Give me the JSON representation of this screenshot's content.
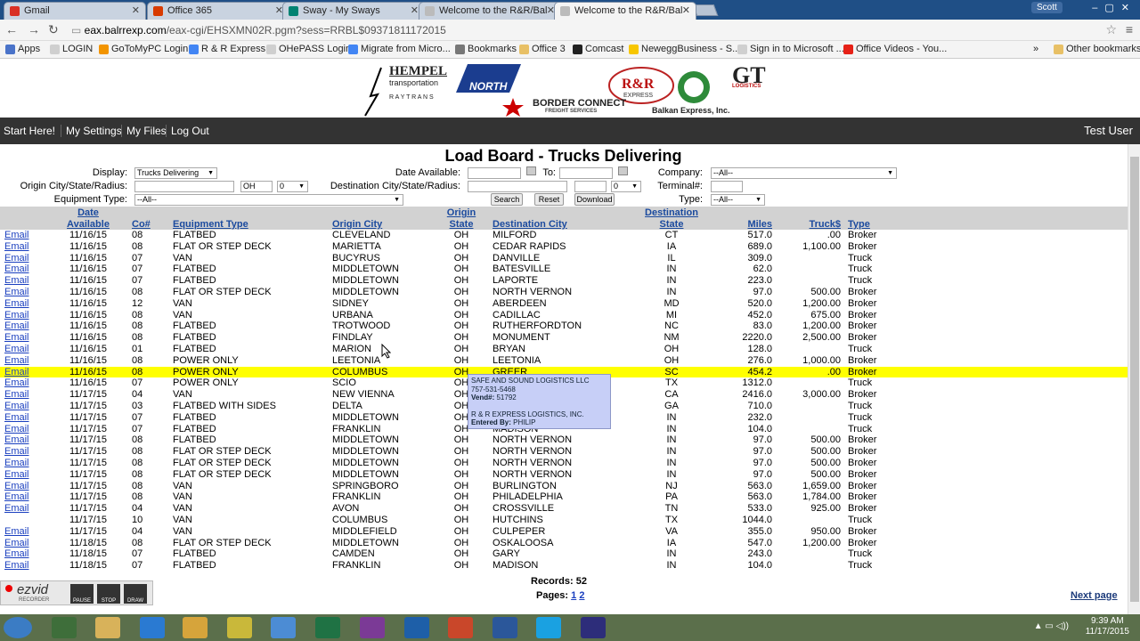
{
  "browser": {
    "tabs": [
      {
        "label": "Gmail",
        "color": "#d93025"
      },
      {
        "label": "Office 365",
        "color": "#d83b01"
      },
      {
        "label": "Sway - My Sways",
        "color": "#008272"
      },
      {
        "label": "Welcome to the R&R/Bal",
        "color": "#999999"
      },
      {
        "label": "Welcome to the R&R/Bal",
        "color": "#999999"
      }
    ],
    "profile": "Scott",
    "url_host": "eax.balrrexp.com",
    "url_path": "/eax-cgi/EHSXMN02R.pgm?sess=RRBL$09371811172015",
    "bookmarks": [
      {
        "label": "Apps",
        "color": "#4a73c9"
      },
      {
        "label": "LOGIN",
        "color": "#cfcfcf"
      },
      {
        "label": "GoToMyPC Login",
        "color": "#f29400"
      },
      {
        "label": "R & R Express",
        "color": "#4285f4"
      },
      {
        "label": "OHePASS Login",
        "color": "#cfcfcf"
      },
      {
        "label": "Migrate from Micro...",
        "color": "#4285f4"
      },
      {
        "label": "Bookmarks",
        "color": "#777777"
      },
      {
        "label": "Office 3",
        "color": "#e8c066"
      },
      {
        "label": "Comcast",
        "color": "#222222"
      },
      {
        "label": "NeweggBusiness - S...",
        "color": "#f7c600"
      },
      {
        "label": "Sign in to Microsoft ...",
        "color": "#cfcfcf"
      },
      {
        "label": "Office Videos - You...",
        "color": "#e62117"
      }
    ],
    "other_bookmarks": "Other bookmarks"
  },
  "logos": {
    "hempel": "HEMPEL",
    "hempel_sub": "transportation",
    "raytrans": "R A Y T R A N S",
    "north": "NORTH",
    "border_connect": "BORDER CONNECT",
    "border_connect_sub": "FREIGHT SERVICES",
    "rr": "R&R",
    "rr_sub": "EXPRESS",
    "gt": "GT",
    "gt_sub": "LOGISTICS",
    "balkan": "Balkan Express, Inc."
  },
  "nav": {
    "start_here": "Start Here!",
    "my_settings": "My Settings",
    "my_files": "My Files",
    "log_out": "Log Out",
    "user": "Test User"
  },
  "page_title": "Load Board - Trucks Delivering",
  "filters": {
    "display_label": "Display:",
    "display_value": "Trucks Delivering",
    "date_available_label": "Date Available:",
    "to_label": "To:",
    "company_label": "Company:",
    "company_value": "--All--",
    "origin_label": "Origin City/State/Radius:",
    "origin_state": "OH",
    "origin_radius": "0",
    "destination_label": "Destination City/State/Radius:",
    "destination_radius": "0",
    "terminal_label": "Terminal#:",
    "equipment_label": "Equipment Type:",
    "equipment_value": "--All--",
    "search_button": "Search",
    "reset_button": "Reset",
    "download_button": "Download",
    "type_label": "Type:",
    "type_value": "--All--"
  },
  "table": {
    "headers": {
      "date_1": "Date",
      "date_2": "Available",
      "co": "Co#",
      "equipment": "Equipment Type",
      "origin_city": "Origin City",
      "origin_state_1": "Origin",
      "origin_state_2": "State",
      "dest_city": "Destination City",
      "dest_state_1": "Destination",
      "dest_state_2": "State",
      "miles": "Miles",
      "truck": "Truck$",
      "type": "Type"
    },
    "rows": [
      {
        "email": "Email",
        "date": "11/16/15",
        "co": "08",
        "equip": "FLATBED",
        "ocity": "CLEVELAND",
        "ost": "OH",
        "dcity": "MILFORD",
        "dst": "CT",
        "miles": "517.0",
        "truck": ".00",
        "type": "Broker"
      },
      {
        "email": "Email",
        "date": "11/16/15",
        "co": "08",
        "equip": "FLAT OR STEP DECK",
        "ocity": "MARIETTA",
        "ost": "OH",
        "dcity": "CEDAR RAPIDS",
        "dst": "IA",
        "miles": "689.0",
        "truck": "1,100.00",
        "type": "Broker"
      },
      {
        "email": "Email",
        "date": "11/16/15",
        "co": "07",
        "equip": "VAN",
        "ocity": "BUCYRUS",
        "ost": "OH",
        "dcity": "DANVILLE",
        "dst": "IL",
        "miles": "309.0",
        "truck": "",
        "type": "Truck"
      },
      {
        "email": "Email",
        "date": "11/16/15",
        "co": "07",
        "equip": "FLATBED",
        "ocity": "MIDDLETOWN",
        "ost": "OH",
        "dcity": "BATESVILLE",
        "dst": "IN",
        "miles": "62.0",
        "truck": "",
        "type": "Truck"
      },
      {
        "email": "Email",
        "date": "11/16/15",
        "co": "07",
        "equip": "FLATBED",
        "ocity": "MIDDLETOWN",
        "ost": "OH",
        "dcity": "LAPORTE",
        "dst": "IN",
        "miles": "223.0",
        "truck": "",
        "type": "Truck"
      },
      {
        "email": "Email",
        "date": "11/16/15",
        "co": "08",
        "equip": "FLAT OR STEP DECK",
        "ocity": "MIDDLETOWN",
        "ost": "OH",
        "dcity": "NORTH VERNON",
        "dst": "IN",
        "miles": "97.0",
        "truck": "500.00",
        "type": "Broker"
      },
      {
        "email": "Email",
        "date": "11/16/15",
        "co": "12",
        "equip": "VAN",
        "ocity": "SIDNEY",
        "ost": "OH",
        "dcity": "ABERDEEN",
        "dst": "MD",
        "miles": "520.0",
        "truck": "1,200.00",
        "type": "Broker"
      },
      {
        "email": "Email",
        "date": "11/16/15",
        "co": "08",
        "equip": "VAN",
        "ocity": "URBANA",
        "ost": "OH",
        "dcity": "CADILLAC",
        "dst": "MI",
        "miles": "452.0",
        "truck": "675.00",
        "type": "Broker"
      },
      {
        "email": "Email",
        "date": "11/16/15",
        "co": "08",
        "equip": "FLATBED",
        "ocity": "TROTWOOD",
        "ost": "OH",
        "dcity": "RUTHERFORDTON",
        "dst": "NC",
        "miles": "83.0",
        "truck": "1,200.00",
        "type": "Broker"
      },
      {
        "email": "Email",
        "date": "11/16/15",
        "co": "08",
        "equip": "FLATBED",
        "ocity": "FINDLAY",
        "ost": "OH",
        "dcity": "MONUMENT",
        "dst": "NM",
        "miles": "2220.0",
        "truck": "2,500.00",
        "type": "Broker"
      },
      {
        "email": "Email",
        "date": "11/16/15",
        "co": "01",
        "equip": "FLATBED",
        "ocity": "MARION",
        "ost": "OH",
        "dcity": "BRYAN",
        "dst": "OH",
        "miles": "128.0",
        "truck": "",
        "type": "Truck"
      },
      {
        "email": "Email",
        "date": "11/16/15",
        "co": "08",
        "equip": "POWER ONLY",
        "ocity": "LEETONIA",
        "ost": "OH",
        "dcity": "LEETONIA",
        "dst": "OH",
        "miles": "276.0",
        "truck": "1,000.00",
        "type": "Broker"
      },
      {
        "email": "Email",
        "date": "11/16/15",
        "co": "08",
        "equip": "POWER ONLY",
        "ocity": "COLUMBUS",
        "ost": "OH",
        "dcity": "GREER",
        "dst": "SC",
        "miles": "454.2",
        "truck": ".00",
        "type": "Broker",
        "highlight": true
      },
      {
        "email": "Email",
        "date": "11/16/15",
        "co": "07",
        "equip": "POWER ONLY",
        "ocity": "SCIO",
        "ost": "OH",
        "dcity": "",
        "dst": "TX",
        "miles": "1312.0",
        "truck": "",
        "type": "Truck"
      },
      {
        "email": "Email",
        "date": "11/17/15",
        "co": "04",
        "equip": "VAN",
        "ocity": "NEW VIENNA",
        "ost": "OH",
        "dcity": "",
        "dst": "CA",
        "miles": "2416.0",
        "truck": "3,000.00",
        "type": "Broker"
      },
      {
        "email": "Email",
        "date": "11/17/15",
        "co": "03",
        "equip": "FLATBED WITH SIDES",
        "ocity": "DELTA",
        "ost": "OH",
        "dcity": "",
        "dst": "GA",
        "miles": "710.0",
        "truck": "",
        "type": "Truck"
      },
      {
        "email": "Email",
        "date": "11/17/15",
        "co": "07",
        "equip": "FLATBED",
        "ocity": "MIDDLETOWN",
        "ost": "OH",
        "dcity": "",
        "dst": "IN",
        "miles": "232.0",
        "truck": "",
        "type": "Truck"
      },
      {
        "email": "Email",
        "date": "11/17/15",
        "co": "07",
        "equip": "FLATBED",
        "ocity": "FRANKLIN",
        "ost": "OH",
        "dcity": "MADISON",
        "dst": "IN",
        "miles": "104.0",
        "truck": "",
        "type": "Truck"
      },
      {
        "email": "Email",
        "date": "11/17/15",
        "co": "08",
        "equip": "FLATBED",
        "ocity": "MIDDLETOWN",
        "ost": "OH",
        "dcity": "NORTH VERNON",
        "dst": "IN",
        "miles": "97.0",
        "truck": "500.00",
        "type": "Broker"
      },
      {
        "email": "Email",
        "date": "11/17/15",
        "co": "08",
        "equip": "FLAT OR STEP DECK",
        "ocity": "MIDDLETOWN",
        "ost": "OH",
        "dcity": "NORTH VERNON",
        "dst": "IN",
        "miles": "97.0",
        "truck": "500.00",
        "type": "Broker"
      },
      {
        "email": "Email",
        "date": "11/17/15",
        "co": "08",
        "equip": "FLAT OR STEP DECK",
        "ocity": "MIDDLETOWN",
        "ost": "OH",
        "dcity": "NORTH VERNON",
        "dst": "IN",
        "miles": "97.0",
        "truck": "500.00",
        "type": "Broker"
      },
      {
        "email": "Email",
        "date": "11/17/15",
        "co": "08",
        "equip": "FLAT OR STEP DECK",
        "ocity": "MIDDLETOWN",
        "ost": "OH",
        "dcity": "NORTH VERNON",
        "dst": "IN",
        "miles": "97.0",
        "truck": "500.00",
        "type": "Broker"
      },
      {
        "email": "Email",
        "date": "11/17/15",
        "co": "08",
        "equip": "VAN",
        "ocity": "SPRINGBORO",
        "ost": "OH",
        "dcity": "BURLINGTON",
        "dst": "NJ",
        "miles": "563.0",
        "truck": "1,659.00",
        "type": "Broker"
      },
      {
        "email": "Email",
        "date": "11/17/15",
        "co": "08",
        "equip": "VAN",
        "ocity": "FRANKLIN",
        "ost": "OH",
        "dcity": "PHILADELPHIA",
        "dst": "PA",
        "miles": "563.0",
        "truck": "1,784.00",
        "type": "Broker"
      },
      {
        "email": "Email",
        "date": "11/17/15",
        "co": "04",
        "equip": "VAN",
        "ocity": "AVON",
        "ost": "OH",
        "dcity": "CROSSVILLE",
        "dst": "TN",
        "miles": "533.0",
        "truck": "925.00",
        "type": "Broker"
      },
      {
        "email": "",
        "date": "11/17/15",
        "co": "10",
        "equip": "VAN",
        "ocity": "COLUMBUS",
        "ost": "OH",
        "dcity": "HUTCHINS",
        "dst": "TX",
        "miles": "1044.0",
        "truck": "",
        "type": "Truck"
      },
      {
        "email": "Email",
        "date": "11/17/15",
        "co": "04",
        "equip": "VAN",
        "ocity": "MIDDLEFIELD",
        "ost": "OH",
        "dcity": "CULPEPER",
        "dst": "VA",
        "miles": "355.0",
        "truck": "950.00",
        "type": "Broker"
      },
      {
        "email": "Email",
        "date": "11/18/15",
        "co": "08",
        "equip": "FLAT OR STEP DECK",
        "ocity": "MIDDLETOWN",
        "ost": "OH",
        "dcity": "OSKALOOSA",
        "dst": "IA",
        "miles": "547.0",
        "truck": "1,200.00",
        "type": "Broker"
      },
      {
        "email": "Email",
        "date": "11/18/15",
        "co": "07",
        "equip": "FLATBED",
        "ocity": "CAMDEN",
        "ost": "OH",
        "dcity": "GARY",
        "dst": "IN",
        "miles": "243.0",
        "truck": "",
        "type": "Truck"
      },
      {
        "email": "Email",
        "date": "11/18/15",
        "co": "07",
        "equip": "FLATBED",
        "ocity": "FRANKLIN",
        "ost": "OH",
        "dcity": "MADISON",
        "dst": "IN",
        "miles": "104.0",
        "truck": "",
        "type": "Truck"
      }
    ]
  },
  "tooltip": {
    "company": "SAFE AND SOUND LOGISTICS LLC",
    "phone": "757-531-5468",
    "vend_label": "Vend#:",
    "vend_value": "51792",
    "carrier": "R & R EXPRESS LOGISTICS, INC.",
    "entered_label": "Entered By:",
    "entered_value": "PHILIP"
  },
  "footer": {
    "records": "Records: 52",
    "pages_label": "Pages: ",
    "page1": "1",
    "page2": "2",
    "next_page": "Next page"
  },
  "recorder": {
    "brand": "ezvid",
    "brand_sub": "RECORDER",
    "pause": "PAUSE",
    "stop": "STOP",
    "draw": "DRAW"
  },
  "taskbar": {
    "time": "9:39 AM",
    "date": "11/17/2015"
  }
}
